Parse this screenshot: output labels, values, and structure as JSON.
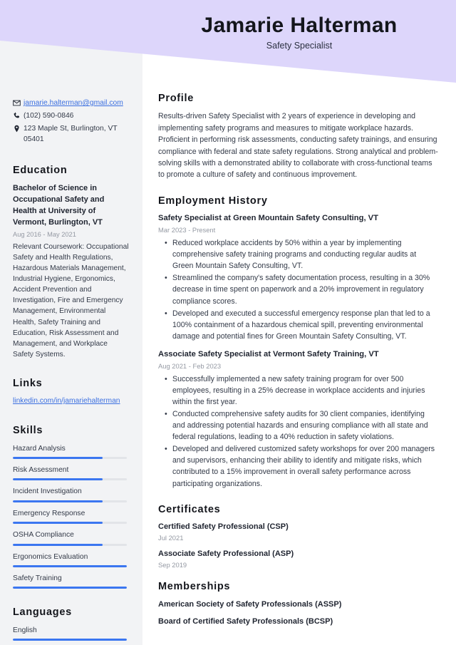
{
  "header": {
    "name": "Jamarie Halterman",
    "job_title": "Safety Specialist",
    "band_color": "#ddd6fb"
  },
  "theme": {
    "accent": "#3b76f0",
    "link": "#3b6fe0",
    "sidebar_bg": "#f2f3f5",
    "heading": "#14161c",
    "muted": "#9499a3"
  },
  "sidebar": {
    "contact": [
      {
        "icon": "email-icon",
        "value": "jamarie.halterman@gmail.com",
        "is_link": true
      },
      {
        "icon": "phone-icon",
        "value": "(102) 590-0846",
        "is_link": false
      },
      {
        "icon": "location-pin-icon",
        "value": "123 Maple St, Burlington, VT 05401",
        "is_link": false
      }
    ],
    "education": {
      "heading": "Education",
      "degree": "Bachelor of Science in Occupational Safety and Health at University of Vermont, Burlington, VT",
      "date": "Aug 2016 - May 2021",
      "description": "Relevant Coursework: Occupational Safety and Health Regulations, Hazardous Materials Management, Industrial Hygiene, Ergonomics, Accident Prevention and Investigation, Fire and Emergency Management, Environmental Health, Safety Training and Education, Risk Assessment and Management, and Workplace Safety Systems."
    },
    "links": {
      "heading": "Links",
      "items": [
        {
          "label": "linkedin.com/in/jamariehalterman"
        }
      ]
    },
    "skills": {
      "heading": "Skills",
      "items": [
        {
          "label": "Hazard Analysis",
          "level": 79
        },
        {
          "label": "Risk Assessment",
          "level": 79
        },
        {
          "label": "Incident Investigation",
          "level": 79
        },
        {
          "label": "Emergency Response",
          "level": 79
        },
        {
          "label": "OSHA Compliance",
          "level": 79
        },
        {
          "label": "Ergonomics Evaluation",
          "level": 100
        },
        {
          "label": "Safety Training",
          "level": 100
        }
      ]
    },
    "languages": {
      "heading": "Languages",
      "items": [
        {
          "label": "English",
          "level": 100
        }
      ]
    }
  },
  "main": {
    "profile": {
      "heading": "Profile",
      "text": "Results-driven Safety Specialist with 2 years of experience in developing and implementing safety programs and measures to mitigate workplace hazards. Proficient in performing risk assessments, conducting safety trainings, and ensuring compliance with federal and state safety regulations. Strong analytical and problem-solving skills with a demonstrated ability to collaborate with cross-functional teams to promote a culture of safety and continuous improvement."
    },
    "employment": {
      "heading": "Employment History",
      "jobs": [
        {
          "title": "Safety Specialist at Green Mountain Safety Consulting, VT",
          "date": "Mar 2023 - Present",
          "bullets": [
            "Reduced workplace accidents by 50% within a year by implementing comprehensive safety training programs and conducting regular audits at Green Mountain Safety Consulting, VT.",
            "Streamlined the company's safety documentation process, resulting in a 30% decrease in time spent on paperwork and a 20% improvement in regulatory compliance scores.",
            "Developed and executed a successful emergency response plan that led to a 100% containment of a hazardous chemical spill, preventing environmental damage and potential fines for Green Mountain Safety Consulting, VT."
          ]
        },
        {
          "title": "Associate Safety Specialist at Vermont Safety Training, VT",
          "date": "Aug 2021 - Feb 2023",
          "bullets": [
            "Successfully implemented a new safety training program for over 500 employees, resulting in a 25% decrease in workplace accidents and injuries within the first year.",
            "Conducted comprehensive safety audits for 30 client companies, identifying and addressing potential hazards and ensuring compliance with all state and federal regulations, leading to a 40% reduction in safety violations.",
            "Developed and delivered customized safety workshops for over 200 managers and supervisors, enhancing their ability to identify and mitigate risks, which contributed to a 15% improvement in overall safety performance across participating organizations."
          ]
        }
      ]
    },
    "certificates": {
      "heading": "Certificates",
      "items": [
        {
          "name": "Certified Safety Professional (CSP)",
          "date": "Jul 2021"
        },
        {
          "name": "Associate Safety Professional (ASP)",
          "date": "Sep 2019"
        }
      ]
    },
    "memberships": {
      "heading": "Memberships",
      "items": [
        {
          "name": "American Society of Safety Professionals (ASSP)"
        },
        {
          "name": "Board of Certified Safety Professionals (BCSP)"
        }
      ]
    }
  }
}
